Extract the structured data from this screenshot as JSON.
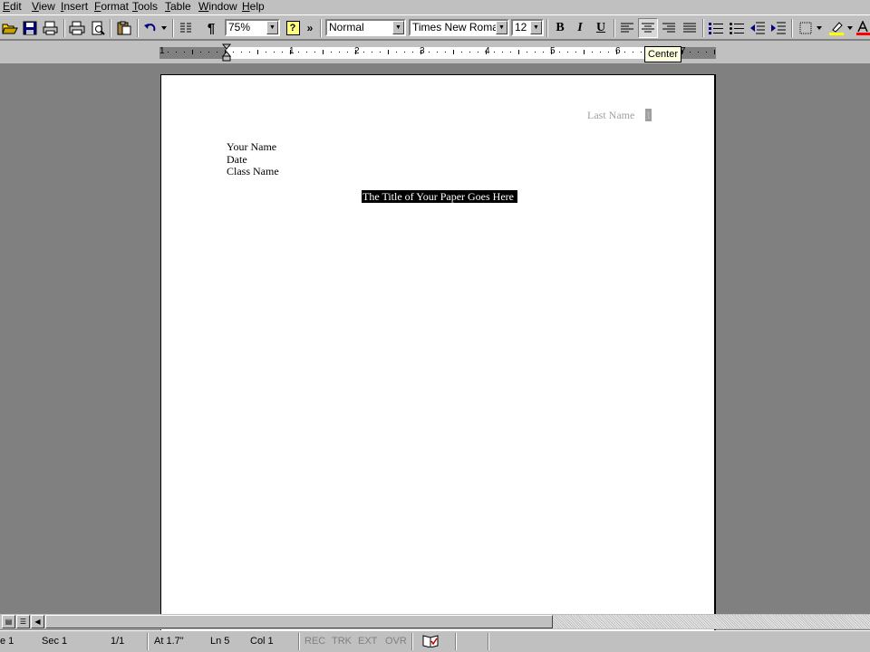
{
  "menubar": {
    "items": [
      {
        "label": "Edit"
      },
      {
        "label": "View"
      },
      {
        "label": "Insert"
      },
      {
        "label": "Format"
      },
      {
        "label": "Tools"
      },
      {
        "label": "Table"
      },
      {
        "label": "Window"
      },
      {
        "label": "Help"
      }
    ]
  },
  "toolbar": {
    "paragraph_mark": "¶",
    "zoom_value": "75%",
    "style_value": "Normal",
    "font_value": "Times New Roman",
    "size_value": "12",
    "bold_label": "B",
    "italic_label": "I",
    "underline_label": "U",
    "help_label": "?",
    "overflow_label": "»",
    "highlight_color": "#ffff00",
    "font_color": "#ff0000",
    "active_alignment": "center"
  },
  "ruler": {
    "numbers": [
      "1",
      "1",
      "2",
      "3",
      "4",
      "5",
      "6",
      "7"
    ],
    "tooltip": "Center"
  },
  "document": {
    "header_last_name": "Last Name",
    "header_page_number": "1",
    "lines": [
      "Your Name",
      "Date",
      "Class Name"
    ],
    "title": "The Title of Your Paper Goes Here"
  },
  "statusbar": {
    "page": "e 1",
    "section": "Sec 1",
    "page_of": "1/1",
    "at": "At 1.7\"",
    "line": "Ln 5",
    "col": "Col 1",
    "rec": "REC",
    "trk": "TRK",
    "ext": "EXT",
    "ovr": "OVR"
  }
}
